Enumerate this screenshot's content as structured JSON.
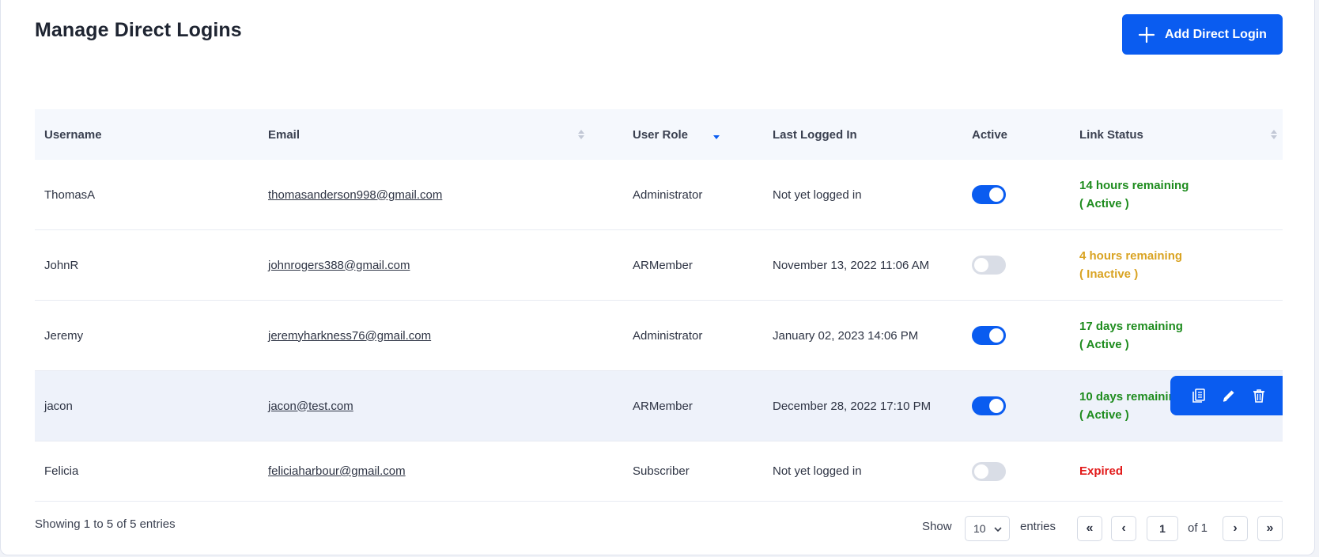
{
  "page": {
    "title": "Manage Direct Logins",
    "add_button_label": "Add Direct Login"
  },
  "colors": {
    "primary": "#0a5cf0",
    "active_status": "#1e8c1e",
    "inactive_status": "#d9a322",
    "expired_status": "#e21b1b"
  },
  "table": {
    "headers": {
      "username": "Username",
      "email": "Email",
      "role": "User Role",
      "last": "Last Logged In",
      "active": "Active",
      "status": "Link Status"
    },
    "rows": [
      {
        "username": "ThomasA",
        "email": "thomasanderson998@gmail.com",
        "role": "Administrator",
        "last": "Not yet logged in",
        "active": true,
        "status_line1": "14 hours remaining",
        "status_line2": "( Active )",
        "status_kind": "active"
      },
      {
        "username": "JohnR",
        "email": "johnrogers388@gmail.com",
        "role": "ARMember",
        "last": "November 13, 2022 11:06 AM",
        "active": false,
        "status_line1": "4 hours remaining",
        "status_line2": "( Inactive )",
        "status_kind": "inactive"
      },
      {
        "username": "Jeremy",
        "email": "jeremyharkness76@gmail.com",
        "role": "Administrator",
        "last": "January 02, 2023 14:06 PM",
        "active": true,
        "status_line1": "17 days remaining",
        "status_line2": "( Active )",
        "status_kind": "active"
      },
      {
        "username": "jacon",
        "email": "jacon@test.com",
        "role": "ARMember",
        "last": "December 28, 2022 17:10 PM",
        "active": true,
        "status_line1": "10 days remaining",
        "status_line2": "( Active )",
        "status_kind": "active"
      },
      {
        "username": "Felicia",
        "email": "feliciaharbour@gmail.com",
        "role": "Subscriber",
        "last": "Not yet logged in",
        "active": false,
        "status_line1": "Expired",
        "status_line2": "",
        "status_kind": "expired"
      }
    ]
  },
  "row_actions": {
    "icons": [
      "copy-icon",
      "edit-icon",
      "delete-icon"
    ]
  },
  "footer": {
    "info": "Showing 1 to 5 of 5 entries",
    "show_label": "Show",
    "per_page": "10",
    "entries_label": "entries",
    "current_page": "1",
    "of_label": "of 1",
    "first": "«",
    "prev": "‹",
    "next": "›",
    "last": "»"
  }
}
